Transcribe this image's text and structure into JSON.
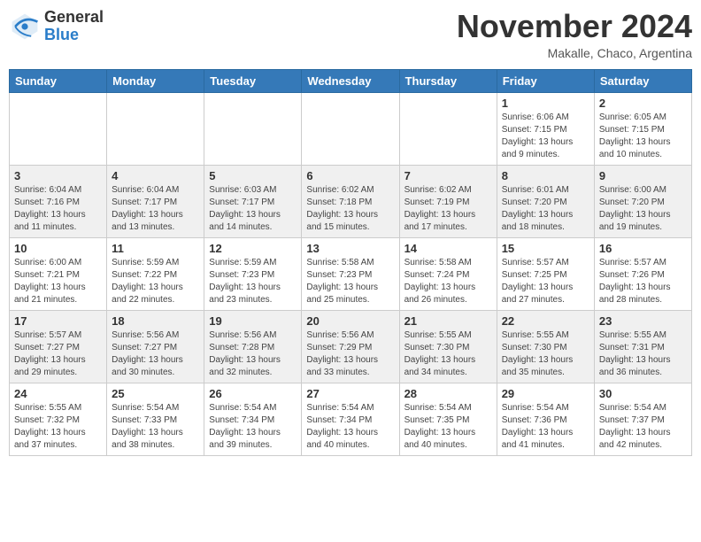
{
  "header": {
    "logo_line1": "General",
    "logo_line2": "Blue",
    "month": "November 2024",
    "location": "Makalle, Chaco, Argentina"
  },
  "weekdays": [
    "Sunday",
    "Monday",
    "Tuesday",
    "Wednesday",
    "Thursday",
    "Friday",
    "Saturday"
  ],
  "weeks": [
    [
      {
        "day": "",
        "info": ""
      },
      {
        "day": "",
        "info": ""
      },
      {
        "day": "",
        "info": ""
      },
      {
        "day": "",
        "info": ""
      },
      {
        "day": "",
        "info": ""
      },
      {
        "day": "1",
        "info": "Sunrise: 6:06 AM\nSunset: 7:15 PM\nDaylight: 13 hours and 9 minutes."
      },
      {
        "day": "2",
        "info": "Sunrise: 6:05 AM\nSunset: 7:15 PM\nDaylight: 13 hours and 10 minutes."
      }
    ],
    [
      {
        "day": "3",
        "info": "Sunrise: 6:04 AM\nSunset: 7:16 PM\nDaylight: 13 hours and 11 minutes."
      },
      {
        "day": "4",
        "info": "Sunrise: 6:04 AM\nSunset: 7:17 PM\nDaylight: 13 hours and 13 minutes."
      },
      {
        "day": "5",
        "info": "Sunrise: 6:03 AM\nSunset: 7:17 PM\nDaylight: 13 hours and 14 minutes."
      },
      {
        "day": "6",
        "info": "Sunrise: 6:02 AM\nSunset: 7:18 PM\nDaylight: 13 hours and 15 minutes."
      },
      {
        "day": "7",
        "info": "Sunrise: 6:02 AM\nSunset: 7:19 PM\nDaylight: 13 hours and 17 minutes."
      },
      {
        "day": "8",
        "info": "Sunrise: 6:01 AM\nSunset: 7:20 PM\nDaylight: 13 hours and 18 minutes."
      },
      {
        "day": "9",
        "info": "Sunrise: 6:00 AM\nSunset: 7:20 PM\nDaylight: 13 hours and 19 minutes."
      }
    ],
    [
      {
        "day": "10",
        "info": "Sunrise: 6:00 AM\nSunset: 7:21 PM\nDaylight: 13 hours and 21 minutes."
      },
      {
        "day": "11",
        "info": "Sunrise: 5:59 AM\nSunset: 7:22 PM\nDaylight: 13 hours and 22 minutes."
      },
      {
        "day": "12",
        "info": "Sunrise: 5:59 AM\nSunset: 7:23 PM\nDaylight: 13 hours and 23 minutes."
      },
      {
        "day": "13",
        "info": "Sunrise: 5:58 AM\nSunset: 7:23 PM\nDaylight: 13 hours and 25 minutes."
      },
      {
        "day": "14",
        "info": "Sunrise: 5:58 AM\nSunset: 7:24 PM\nDaylight: 13 hours and 26 minutes."
      },
      {
        "day": "15",
        "info": "Sunrise: 5:57 AM\nSunset: 7:25 PM\nDaylight: 13 hours and 27 minutes."
      },
      {
        "day": "16",
        "info": "Sunrise: 5:57 AM\nSunset: 7:26 PM\nDaylight: 13 hours and 28 minutes."
      }
    ],
    [
      {
        "day": "17",
        "info": "Sunrise: 5:57 AM\nSunset: 7:27 PM\nDaylight: 13 hours and 29 minutes."
      },
      {
        "day": "18",
        "info": "Sunrise: 5:56 AM\nSunset: 7:27 PM\nDaylight: 13 hours and 30 minutes."
      },
      {
        "day": "19",
        "info": "Sunrise: 5:56 AM\nSunset: 7:28 PM\nDaylight: 13 hours and 32 minutes."
      },
      {
        "day": "20",
        "info": "Sunrise: 5:56 AM\nSunset: 7:29 PM\nDaylight: 13 hours and 33 minutes."
      },
      {
        "day": "21",
        "info": "Sunrise: 5:55 AM\nSunset: 7:30 PM\nDaylight: 13 hours and 34 minutes."
      },
      {
        "day": "22",
        "info": "Sunrise: 5:55 AM\nSunset: 7:30 PM\nDaylight: 13 hours and 35 minutes."
      },
      {
        "day": "23",
        "info": "Sunrise: 5:55 AM\nSunset: 7:31 PM\nDaylight: 13 hours and 36 minutes."
      }
    ],
    [
      {
        "day": "24",
        "info": "Sunrise: 5:55 AM\nSunset: 7:32 PM\nDaylight: 13 hours and 37 minutes."
      },
      {
        "day": "25",
        "info": "Sunrise: 5:54 AM\nSunset: 7:33 PM\nDaylight: 13 hours and 38 minutes."
      },
      {
        "day": "26",
        "info": "Sunrise: 5:54 AM\nSunset: 7:34 PM\nDaylight: 13 hours and 39 minutes."
      },
      {
        "day": "27",
        "info": "Sunrise: 5:54 AM\nSunset: 7:34 PM\nDaylight: 13 hours and 40 minutes."
      },
      {
        "day": "28",
        "info": "Sunrise: 5:54 AM\nSunset: 7:35 PM\nDaylight: 13 hours and 40 minutes."
      },
      {
        "day": "29",
        "info": "Sunrise: 5:54 AM\nSunset: 7:36 PM\nDaylight: 13 hours and 41 minutes."
      },
      {
        "day": "30",
        "info": "Sunrise: 5:54 AM\nSunset: 7:37 PM\nDaylight: 13 hours and 42 minutes."
      }
    ]
  ]
}
